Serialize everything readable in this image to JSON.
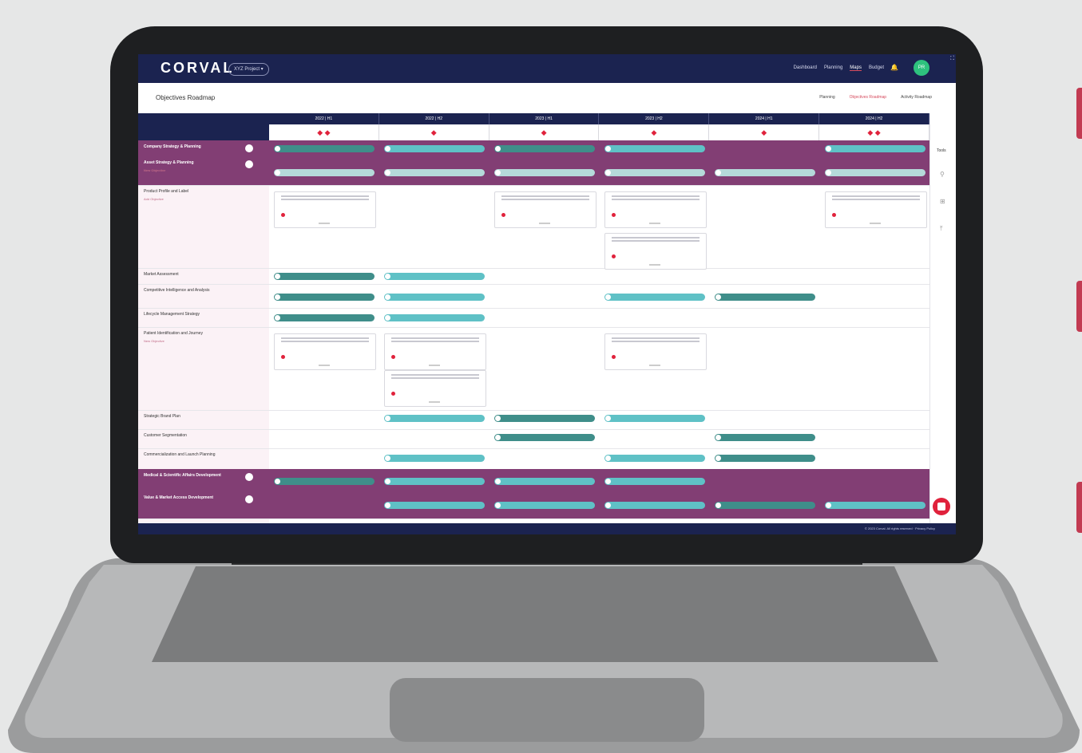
{
  "app": {
    "logo": "CORVAL",
    "project": "XYZ Project ▾",
    "nav": [
      "Dashboard",
      "Planning",
      "Maps",
      "Budget"
    ],
    "active_nav": "Maps",
    "avatar": "PR"
  },
  "page": {
    "title": "Objectives Roadmap",
    "views": [
      "Planning",
      "Objectives Roadmap",
      "Activity Roadmap"
    ],
    "selected_view": "Objectives Roadmap"
  },
  "periods": [
    "2022 | H1",
    "2022 | H2",
    "2023 | H1",
    "2023 | H2",
    "2024 | H1",
    "2024 | H2"
  ],
  "milestone_counts": [
    2,
    1,
    1,
    1,
    1,
    2
  ],
  "tools": {
    "label": "Tools"
  },
  "rows": [
    {
      "name": "Company Strategy & Planning",
      "type": "group"
    },
    {
      "name": "Asset Strategy & Planning",
      "type": "group",
      "sub": "New Objective"
    },
    {
      "name": "Product Profile and Label",
      "sub": "Add Objective"
    },
    {
      "name": "Market Assessment"
    },
    {
      "name": "Competitive Intelligence and Analysis"
    },
    {
      "name": "Lifecycle Management Strategy"
    },
    {
      "name": "Patient Identification and Journey",
      "sub": "New Objective"
    },
    {
      "name": "Strategic Brand Plan"
    },
    {
      "name": "Customer Segmentation"
    },
    {
      "name": "Commercialization and Launch Planning"
    },
    {
      "name": "Medical & Scientific Affairs Development",
      "type": "group"
    },
    {
      "name": "Value & Market Access Development",
      "type": "group"
    }
  ],
  "footer": {
    "copy": "© 2023 Corval. All rights reserved · Privacy Policy"
  },
  "colors": {
    "navy": "#1b2350",
    "plum": "#823e74",
    "teal": "#5fc1c6",
    "teal_dark": "#3f8e8a",
    "red": "#e0223c"
  }
}
